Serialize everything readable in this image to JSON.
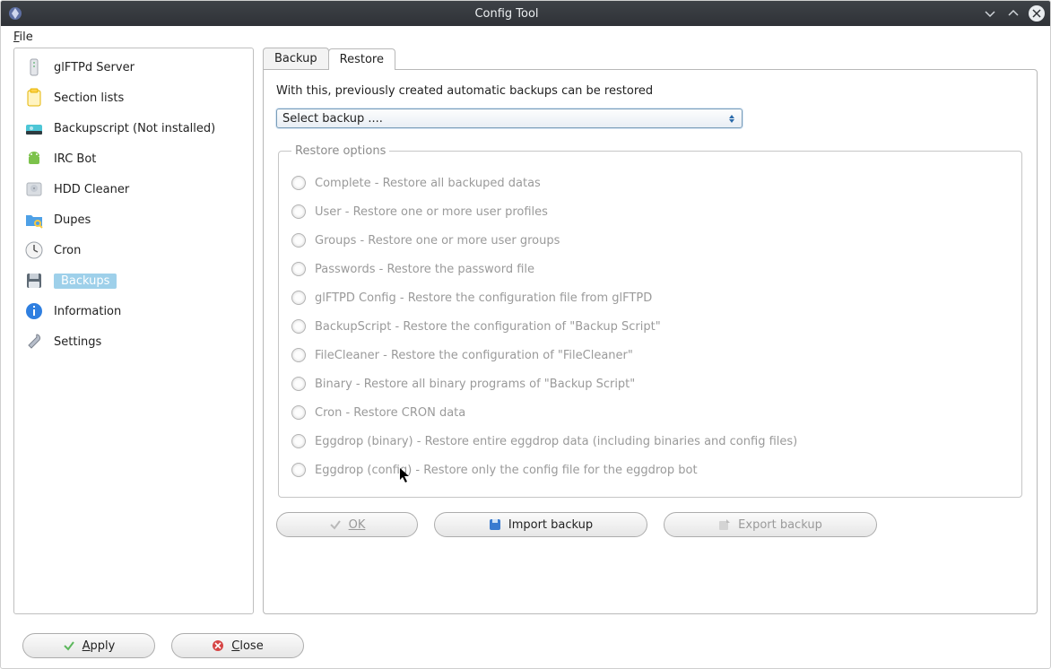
{
  "window": {
    "title": "Config Tool"
  },
  "menubar": {
    "file": "File"
  },
  "sidebar": {
    "items": [
      {
        "label": "glFTPd Server"
      },
      {
        "label": "Section lists"
      },
      {
        "label": "Backupscript (Not installed)"
      },
      {
        "label": "IRC Bot"
      },
      {
        "label": "HDD Cleaner"
      },
      {
        "label": "Dupes"
      },
      {
        "label": "Cron"
      },
      {
        "label": "Backups"
      },
      {
        "label": "Information"
      },
      {
        "label": "Settings"
      }
    ]
  },
  "tabs": {
    "backup": "Backup",
    "restore": "Restore"
  },
  "panel": {
    "desc": "With this, previously created automatic backups can be restored",
    "select_value": "Select backup ....",
    "legend": "Restore options",
    "options": {
      "complete": "Complete - Restore all backuped datas",
      "user": "User - Restore one or more user profiles",
      "groups": "Groups - Restore one or more user groups",
      "passwords": "Passwords - Restore the password file",
      "glftpd": "glFTPD Config - Restore the configuration file from glFTPD",
      "backupscript": "BackupScript - Restore the configuration of \"Backup Script\"",
      "filecleaner": "FileCleaner - Restore the configuration of \"FileCleaner\"",
      "binary": "Binary - Restore all binary programs of \"Backup Script\"",
      "cron": "Cron - Restore CRON data",
      "eggdrop_bin": "Eggdrop (binary) - Restore  entire eggdrop data (including binaries and config files)",
      "eggdrop_cfg": "Eggdrop (config) - Restore only the config file for the eggdrop bot"
    },
    "buttons": {
      "ok": "OK",
      "import": "Import backup",
      "export": "Export backup"
    }
  },
  "footer": {
    "apply": "Apply",
    "close": "Close"
  }
}
